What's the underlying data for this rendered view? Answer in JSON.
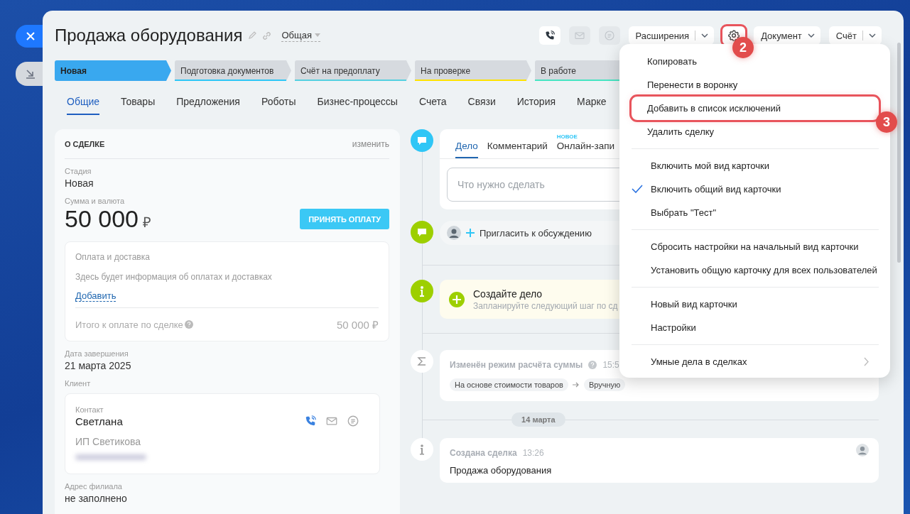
{
  "header": {
    "title": "Продажа оборудования",
    "category": "Общая",
    "icon_buttons": [
      {
        "kind": "call",
        "disabled": false
      },
      {
        "kind": "email",
        "disabled": true
      },
      {
        "kind": "chat",
        "disabled": true
      }
    ],
    "toolbar": [
      {
        "kind": "split",
        "label": "Расширения"
      },
      {
        "kind": "settings",
        "highlighted": true,
        "callout": "2"
      },
      {
        "kind": "dropdown",
        "label": "Документ"
      },
      {
        "kind": "split",
        "label": "Счёт"
      }
    ]
  },
  "stages": [
    {
      "label": "Новая",
      "selected": true,
      "color": "#39a8ef"
    },
    {
      "label": "Подготовка документов",
      "selected": false,
      "color": "#2fc6f6"
    },
    {
      "label": "Счёт на предоплату",
      "selected": false,
      "color": "#55d0e0"
    },
    {
      "label": "На проверке",
      "selected": false,
      "color": "#ffe200"
    },
    {
      "label": "В работе",
      "selected": false,
      "color": "#47e4c2"
    }
  ],
  "tabs": [
    {
      "label": "Общие",
      "selected": true
    },
    {
      "label": "Товары",
      "selected": false
    },
    {
      "label": "Предложения",
      "selected": false
    },
    {
      "label": "Роботы",
      "selected": false
    },
    {
      "label": "Бизнес-процессы",
      "selected": false
    },
    {
      "label": "Счета",
      "selected": false
    },
    {
      "label": "Связи",
      "selected": false
    },
    {
      "label": "История",
      "selected": false
    },
    {
      "label": "Марке",
      "selected": false
    }
  ],
  "deal": {
    "title": "О СДЕЛКЕ",
    "edit": "изменить",
    "stage": {
      "label": "Стадия",
      "value": "Новая"
    },
    "amount": {
      "label": "Сумма и валюта",
      "value": "50 000",
      "currency": "₽",
      "button": "ПРИНЯТЬ ОПЛАТУ"
    },
    "payment": {
      "title": "Оплата и доставка",
      "info": "Здесь будет информация об оплатах и доставках",
      "add": "Добавить",
      "total_label": "Итого к оплате по сделке",
      "total_value": "50 000 ₽"
    },
    "close_date": {
      "label": "Дата завершения",
      "value": "21 марта 2025"
    },
    "client": {
      "label": "Клиент",
      "contact_label": "Контакт",
      "name": "Светлана",
      "company": "ИП Светикова"
    },
    "address": {
      "label": "Адрес филиала",
      "value": "не заполнено"
    }
  },
  "timeline": {
    "composer": {
      "tabs": [
        {
          "label": "Дело",
          "selected": true
        },
        {
          "label": "Комментарий",
          "selected": false
        },
        {
          "label": "Онлайн-запи",
          "selected": false,
          "badge": "НОВОЕ"
        }
      ],
      "placeholder": "Что нужно сделать"
    },
    "invite": "Пригласить к обсуждению",
    "todo": {
      "title": "Создайте дело",
      "subtitle": "Запланируйте следующий шаг по сд"
    },
    "sum_event": {
      "title": "Изменён режим расчёта суммы",
      "time": "15:5",
      "from": "На основе стоимости товаров",
      "to": "Вручную"
    },
    "date": "14 марта",
    "created_event": {
      "title": "Создана сделка",
      "time": "13:26",
      "text": "Продажа оборудования"
    }
  },
  "menu": {
    "groups": [
      [
        {
          "label": "Копировать",
          "checked": false,
          "submenu": false,
          "highlighted": false
        },
        {
          "label": "Перенести в воронку",
          "checked": false,
          "submenu": false,
          "highlighted": false
        },
        {
          "label": "Добавить в список исключений",
          "checked": false,
          "submenu": false,
          "highlighted": true,
          "callout": "3"
        },
        {
          "label": "Удалить сделку",
          "checked": false,
          "submenu": false,
          "highlighted": false
        }
      ],
      [
        {
          "label": "Включить мой вид карточки",
          "checked": false,
          "submenu": false,
          "highlighted": false
        },
        {
          "label": "Включить общий вид карточки",
          "checked": true,
          "submenu": false,
          "highlighted": false
        },
        {
          "label": "Выбрать \"Тест\"",
          "checked": false,
          "submenu": false,
          "highlighted": false
        }
      ],
      [
        {
          "label": "Сбросить настройки на начальный вид карточки",
          "checked": false,
          "submenu": false,
          "highlighted": false
        },
        {
          "label": "Установить общую карточку для всех пользователей",
          "checked": false,
          "submenu": false,
          "highlighted": false
        }
      ],
      [
        {
          "label": "Новый вид карточки",
          "checked": false,
          "submenu": false,
          "highlighted": false
        },
        {
          "label": "Настройки",
          "checked": false,
          "submenu": false,
          "highlighted": false
        }
      ],
      [
        {
          "label": "Умные дела в сделках",
          "checked": false,
          "submenu": true,
          "highlighted": false
        }
      ]
    ]
  }
}
